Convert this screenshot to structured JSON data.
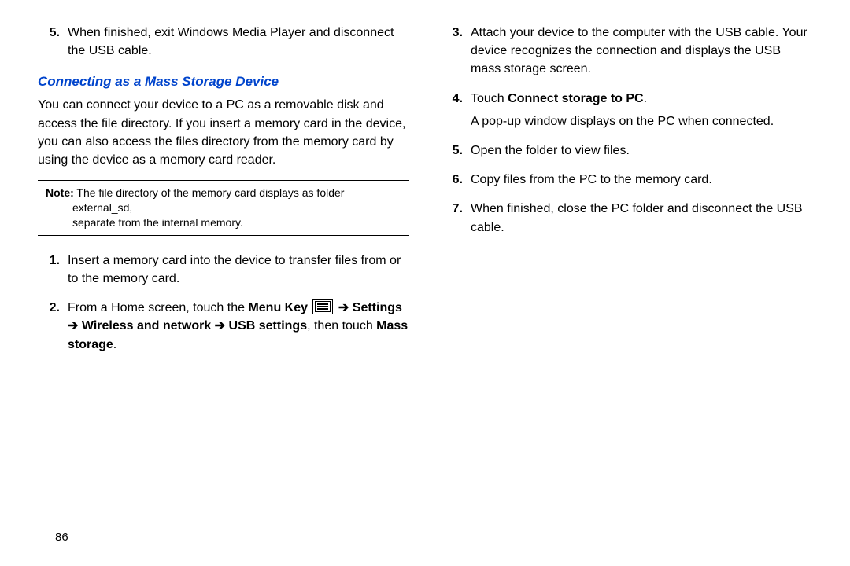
{
  "left": {
    "step5_num": "5.",
    "step5_text": "When finished, exit Windows Media Player and disconnect the USB cable.",
    "heading": "Connecting as a Mass Storage Device",
    "intro": "You can connect your device to a PC as a removable disk and access the file directory. If you insert a memory card in the device, you can also access the files directory from the memory card by using the device as a memory card reader.",
    "note_label": "Note:",
    "note_text_a": " The file directory of the memory card displays as folder external_sd,",
    "note_text_b": "separate from the internal memory.",
    "step1_num": "1.",
    "step1_text": "Insert a memory card into the device to transfer files from or to the memory card.",
    "step2_num": "2.",
    "step2_pre": "From a Home screen, touch the ",
    "step2_menu_key": "Menu Key",
    "step2_arrow1": " ➔ ",
    "step2_settings": "Settings",
    "step2_arrow2": " ➔ ",
    "step2_wireless": "Wireless and network",
    "step2_arrow3": " ➔ ",
    "step2_usb": "USB settings",
    "step2_then": ", then touch ",
    "step2_mass": "Mass storage",
    "step2_period": "."
  },
  "right": {
    "step3_num": "3.",
    "step3_text": "Attach your device to the computer with the USB cable. Your device recognizes the connection and displays the USB mass storage screen.",
    "step4_num": "4.",
    "step4_pre": "Touch ",
    "step4_bold": "Connect storage to PC",
    "step4_post": ".",
    "step4_sub": "A pop-up window displays on the PC when connected.",
    "step5_num": "5.",
    "step5_text": "Open the folder to view files.",
    "step6_num": "6.",
    "step6_text": "Copy files from the PC to the memory card.",
    "step7_num": "7.",
    "step7_text": "When finished, close the PC folder and disconnect the USB cable."
  },
  "page_number": "86"
}
